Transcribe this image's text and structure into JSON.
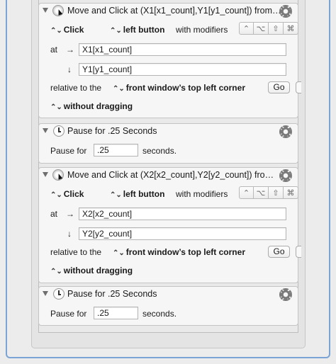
{
  "actions": [
    {
      "kind": "move-click",
      "title": "Move and Click at (X1[x1_count],Y1[y1_count]) from…",
      "click_label": "Click",
      "button_label": "left button",
      "modifiers_label": "with modifiers",
      "modifier_keys": [
        "⌃",
        "⌥",
        "⇧",
        "⌘"
      ],
      "at_label": "at",
      "x_arrow": "→",
      "x_value": "X1[x1_count]",
      "y_arrow": "↓",
      "y_value": "Y1[y1_count]",
      "relative_label": "relative to the",
      "relative_value": "front window’s top left corner",
      "go_label": "Go",
      "drag_value": "without dragging"
    },
    {
      "kind": "pause",
      "title": "Pause for .25 Seconds",
      "pause_label": "Pause for",
      "pause_value": ".25",
      "seconds_label": "seconds."
    },
    {
      "kind": "move-click",
      "title": "Move and Click at (X2[x2_count],Y2[y2_count]) fro…",
      "click_label": "Click",
      "button_label": "left button",
      "modifiers_label": "with modifiers",
      "modifier_keys": [
        "⌃",
        "⌥",
        "⇧",
        "⌘"
      ],
      "at_label": "at",
      "x_arrow": "→",
      "x_value": "X2[x2_count]",
      "y_arrow": "↓",
      "y_value": "Y2[y2_count]",
      "relative_label": "relative to the",
      "relative_value": "front window’s top left corner",
      "go_label": "Go",
      "drag_value": "without dragging"
    },
    {
      "kind": "pause",
      "title": "Pause for .25 Seconds",
      "pause_label": "Pause for",
      "pause_value": ".25",
      "seconds_label": "seconds."
    }
  ],
  "popup_arrows": "⌃⌄",
  "colors": {
    "focus_border": "#7aa3d6",
    "panel_bg": "#f6f6f6"
  }
}
